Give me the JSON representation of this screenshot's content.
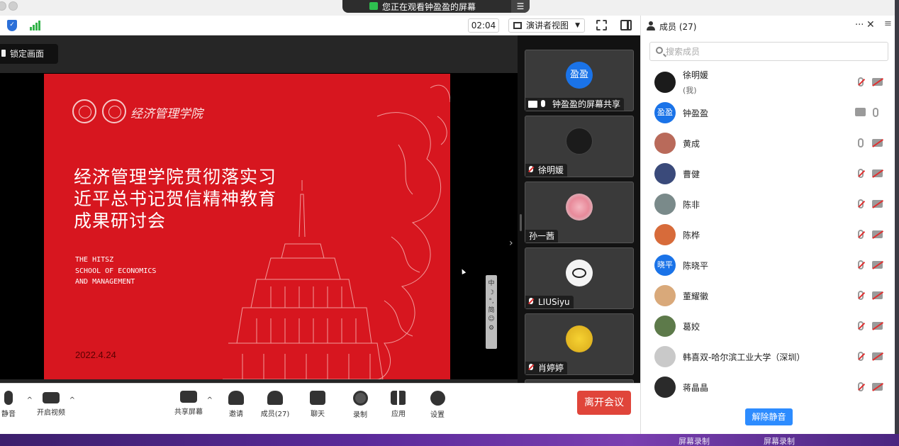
{
  "banner": {
    "text": "您正在观看钟盈盈的屏幕",
    "menu_icon": "menu-icon"
  },
  "meeting": {
    "timer": "02:04",
    "view_label": "演讲者视图",
    "lock_label": "锁定画面"
  },
  "slide": {
    "logo_text": "经济管理学院",
    "title_lines": [
      "经济管理学院贯彻落实习",
      "近平总书记贺信精神教育",
      "成果研讨会"
    ],
    "subtitle_lines": [
      "THE HITSZ",
      "SCHOOL OF ECONOMICS",
      "AND MANAGEMENT"
    ],
    "date": "2022.4.24",
    "tool_glyphs": "中\n☽\n°,\n简\n☺\n⚙"
  },
  "gallery": [
    {
      "name": "钟盈盈的屏幕共享",
      "avatar_text": "盈盈",
      "avatar_color": "#1a73e8"
    },
    {
      "name": "徐明媛",
      "avatar_text": "",
      "avatar_color": "#1b1b1b"
    },
    {
      "name": "孙一茜",
      "avatar_text": "",
      "avatar_color": "#e9a8b0"
    },
    {
      "name": "LIUSiyu",
      "avatar_text": "",
      "avatar_color": "#f4f4f4"
    },
    {
      "name": "肖婷婷",
      "avatar_text": "",
      "avatar_color": "#e8c21c"
    }
  ],
  "toolbar": {
    "mute_label": "静音",
    "video_label": "开启视频",
    "share_label": "共享屏幕",
    "invite_label": "邀请",
    "members_label": "成员(27)",
    "chat_label": "聊天",
    "record_label": "录制",
    "apps_label": "应用",
    "settings_label": "设置",
    "leave_label": "离开会议"
  },
  "panel": {
    "title": "成员 (27)",
    "more": "···",
    "close": "✕",
    "hamburger": "≡",
    "search_placeholder": "搜索成员",
    "unmute_all": "解除静音",
    "members": [
      {
        "name": "徐明媛",
        "sub": "(我)",
        "avatar_text": "",
        "avatar_color": "#1b1b1b",
        "mic_muted": true,
        "cam_off": true,
        "sharing": false
      },
      {
        "name": "钟盈盈",
        "sub": "",
        "avatar_text": "盈盈",
        "avatar_color": "#1a73e8",
        "mic_muted": false,
        "cam_off": false,
        "sharing": true
      },
      {
        "name": "黄成",
        "sub": "",
        "avatar_text": "",
        "avatar_color": "#b96a5a",
        "mic_muted": false,
        "cam_off": true,
        "sharing": false
      },
      {
        "name": "曹健",
        "sub": "",
        "avatar_text": "",
        "avatar_color": "#3a4a7a",
        "mic_muted": true,
        "cam_off": true,
        "sharing": false
      },
      {
        "name": "陈非",
        "sub": "",
        "avatar_text": "",
        "avatar_color": "#7a8a8a",
        "mic_muted": true,
        "cam_off": true,
        "sharing": false
      },
      {
        "name": "陈桦",
        "sub": "",
        "avatar_text": "",
        "avatar_color": "#d76b3a",
        "mic_muted": true,
        "cam_off": true,
        "sharing": false
      },
      {
        "name": "陈晓平",
        "sub": "",
        "avatar_text": "晓平",
        "avatar_color": "#1a73e8",
        "mic_muted": true,
        "cam_off": true,
        "sharing": false
      },
      {
        "name": "董耀徽",
        "sub": "",
        "avatar_text": "",
        "avatar_color": "#d9a97a",
        "mic_muted": true,
        "cam_off": true,
        "sharing": false
      },
      {
        "name": "葛姣",
        "sub": "",
        "avatar_text": "",
        "avatar_color": "#5d7a4a",
        "mic_muted": true,
        "cam_off": true,
        "sharing": false
      },
      {
        "name": "韩喜双-哈尔滨工业大学（深圳）",
        "sub": "",
        "avatar_text": "",
        "avatar_color": "#c9c9c9",
        "mic_muted": true,
        "cam_off": true,
        "sharing": false
      },
      {
        "name": "蒋晶晶",
        "sub": "",
        "avatar_text": "",
        "avatar_color": "#2a2a2a",
        "mic_muted": true,
        "cam_off": true,
        "sharing": false
      }
    ]
  },
  "desktop": {
    "labels": [
      "屏幕录制",
      "屏幕录制"
    ]
  }
}
